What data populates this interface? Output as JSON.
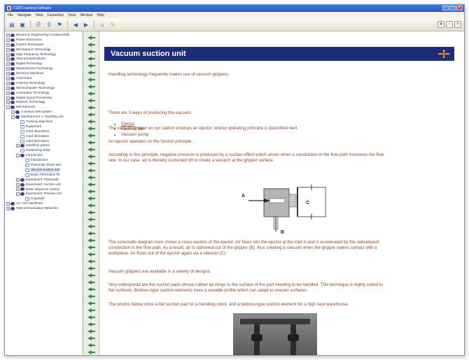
{
  "window": {
    "title": "CCBI Learning Software",
    "menus": [
      "File",
      "Navigate",
      "View",
      "Favourites",
      "Tools",
      "Window",
      "Help"
    ]
  },
  "toolbar": {
    "buttons": [
      "back",
      "forward",
      "home",
      "print",
      "search",
      "bookmark"
    ]
  },
  "tree": {
    "items": [
      {
        "label": "Electronic Engineering Fundamentals",
        "level": 0,
        "type": "book",
        "expander": "+"
      },
      {
        "label": "Power Electronics",
        "level": 0,
        "type": "book",
        "expander": "+"
      },
      {
        "label": "Control Techniques",
        "level": 0,
        "type": "book",
        "expander": "+"
      },
      {
        "label": "Mechatronic Technology",
        "level": 0,
        "type": "book",
        "expander": "+"
      },
      {
        "label": "High Frequency Technology",
        "level": 0,
        "type": "book",
        "expander": "+"
      },
      {
        "label": "Telecommunications",
        "level": 0,
        "type": "book",
        "expander": "+"
      },
      {
        "label": "Digital Technology",
        "level": 0,
        "type": "book",
        "expander": "+"
      },
      {
        "label": "Measurement Technology",
        "level": 0,
        "type": "book",
        "expander": "+"
      },
      {
        "label": "Electrical Machines",
        "level": 0,
        "type": "book",
        "expander": "+"
      },
      {
        "label": "Automotive",
        "level": 0,
        "type": "book",
        "expander": "+"
      },
      {
        "label": "Antenna Technology",
        "level": 0,
        "type": "book",
        "expander": "+"
      },
      {
        "label": "Microcomputer Technology",
        "level": 0,
        "type": "book",
        "expander": "+"
      },
      {
        "label": "Automation Technology",
        "level": 0,
        "type": "book",
        "expander": "+"
      },
      {
        "label": "Digital Signal Processing",
        "level": 0,
        "type": "book",
        "expander": "+"
      },
      {
        "label": "Network Technology",
        "level": 0,
        "type": "book",
        "expander": "+"
      },
      {
        "label": "Mechatronics",
        "level": 0,
        "type": "book",
        "expander": "-"
      },
      {
        "label": "Conveyor belt system",
        "level": 1,
        "type": "book",
        "expander": "+"
      },
      {
        "label": "Mechatronics 1: Handling unit",
        "level": 1,
        "type": "book",
        "expander": "-"
      },
      {
        "label": "Training objectives",
        "level": 2,
        "type": "page",
        "expander": ""
      },
      {
        "label": "Equipment",
        "level": 2,
        "type": "page",
        "expander": ""
      },
      {
        "label": "Card description",
        "level": 2,
        "type": "page",
        "expander": ""
      },
      {
        "label": "Card description",
        "level": 2,
        "type": "page",
        "expander": ""
      },
      {
        "label": "Card description",
        "level": 2,
        "type": "page",
        "expander": ""
      },
      {
        "label": "Handling system",
        "level": 2,
        "type": "book",
        "expander": "+"
      },
      {
        "label": "Positioning setup",
        "level": 2,
        "type": "page",
        "expander": ""
      },
      {
        "label": "Introduction",
        "level": 2,
        "type": "book",
        "expander": "-"
      },
      {
        "label": "Introduction",
        "level": 3,
        "type": "page",
        "expander": ""
      },
      {
        "label": "Pneumatic linear axis",
        "level": 3,
        "type": "page",
        "expander": ""
      },
      {
        "label": "Vacuum suction unit",
        "level": 3,
        "type": "page",
        "expander": "",
        "selected": true
      },
      {
        "label": "Basic information for",
        "level": 3,
        "type": "page",
        "expander": ""
      },
      {
        "label": "Experiment: Pneumatic",
        "level": 2,
        "type": "book",
        "expander": "+"
      },
      {
        "label": "Experiment: Suction unit",
        "level": 2,
        "type": "book",
        "expander": "+"
      },
      {
        "label": "Basic sequence control",
        "level": 2,
        "type": "book",
        "expander": "+"
      },
      {
        "label": "Experiment: Process con",
        "level": 2,
        "type": "book",
        "expander": "+"
      },
      {
        "label": "Copyright",
        "level": 3,
        "type": "page",
        "expander": ""
      },
      {
        "label": "AC / DC Machines",
        "level": 0,
        "type": "book",
        "expander": "+"
      },
      {
        "label": "Telecommunication Networks",
        "level": 0,
        "type": "book",
        "expander": "+"
      }
    ]
  },
  "content": {
    "title": "Vacuum suction unit",
    "intro": "Handling technology frequently makes use of vacuum grippers.",
    "ways_intro": "There are 3 ways of producing the vacuum:",
    "ways": [
      "Ejector",
      "Vacuum fan",
      "Vacuum pump"
    ],
    "para_gripper": "The vacuum gripper on our station employs an ejector, whose operating principle is described next.",
    "para_venturi": "An ejector operates on the Venturi principle.",
    "para_principle_1": "According to this principle, negative pressure is produced by a suction effect which arises when a constriction in the flow path increases the flow",
    "para_principle_2": "rate. In our case, air is thereby suctioned off to create a vacuum at the gripper surface.",
    "diagram_labels": {
      "a": "A",
      "b": "B",
      "c": "C"
    },
    "para_schematic_1": "The schematic diagram here shows a cross-section of the ejector. Air flows into the ejector at the inlet A and is accelerated by the subsequent",
    "para_schematic_2": "constriction in the flow path. As a result, air is siphoned out of the gripper (B), thus creating a vacuum when the gripper makes contact with a",
    "para_schematic_3": "workpiece. Air flows out of the ejector again via a silencer (C).",
    "para_designs": "Vacuum grippers are available in a variety of designs.",
    "para_pads_1": "Very widespread are flat suction pads whose rubber lip clings to the surface of the part needing to be handled. This technique is highly suited to",
    "para_pads_2": "flat surfaces. Bellows-type suction elements have a variable profile which can adapt to uneven surfaces.",
    "para_photos": "The photos below show a flat suction pad for a handling robot, and a bellows-type suction element for a high rack warehouse."
  },
  "colors": {
    "header_bg": "#1b2f78",
    "body_text": "#8a4a2c",
    "strip_bg": "#e6efe4",
    "strip_mark": "#3e8a3e"
  }
}
